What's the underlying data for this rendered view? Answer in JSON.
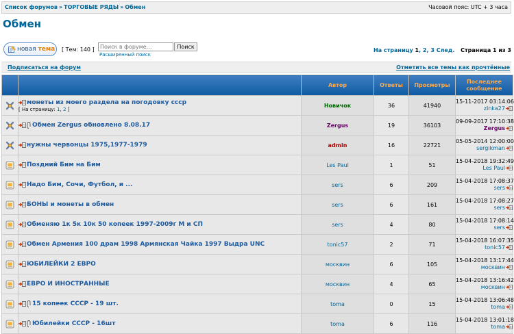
{
  "breadcrumb": {
    "items": [
      "Список форумов",
      "ТОРГОВЫЕ РЯДЫ",
      "Обмен"
    ],
    "separator": "»"
  },
  "timezone": "Часовой пояс: UTC + 3 часа",
  "forum_title": "Обмен",
  "new_topic": {
    "prefix": "новая ",
    "accent": "тема"
  },
  "topics_count": "[ Тем: 140 ]",
  "search": {
    "placeholder": "Поиск в форуме…",
    "button": "Поиск",
    "advanced": "Расширенный поиск"
  },
  "pagination": {
    "prefix": "На страницу",
    "pages": [
      "1",
      "2",
      "3"
    ],
    "current": "1",
    "next": "След.",
    "info": "Страница 1 из 3"
  },
  "actions": {
    "subscribe": "Подписаться на форум",
    "mark_read": "Отметить все темы как прочтённые"
  },
  "columns": {
    "author": "Автор",
    "replies": "Ответы",
    "views": "Просмотры",
    "last_post": "Последнее сообщение"
  },
  "colors": {
    "header_text": "#ffa94a",
    "link": "#006699",
    "topic_link": "#1d5a9e",
    "author_green": "#006600",
    "author_purple": "#660066",
    "author_red": "#aa0000"
  },
  "topics": [
    {
      "icon": "sticky-icon",
      "attachment": false,
      "title": "монеты из моего раздела на погодовку ссср",
      "pages_label": "[ На страницу:",
      "pages": [
        "1",
        "2"
      ],
      "pages_suffix": "]",
      "author": "Новичок",
      "author_color": "#006600",
      "replies": "36",
      "views": "41940",
      "last_date": "15-11-2017 03:14:06",
      "last_user": "zinka27",
      "last_user_color": "#006699"
    },
    {
      "icon": "sticky-icon",
      "attachment": true,
      "title": "Обмен Zergus обновлено 8.08.17",
      "author": "Zergus",
      "author_color": "#660066",
      "replies": "19",
      "views": "36103",
      "last_date": "09-09-2017 17:10:38",
      "last_user": "Zergus",
      "last_user_color": "#660066"
    },
    {
      "icon": "sticky-icon",
      "attachment": false,
      "title": "нужны червонцы 1975,1977-1979",
      "author": "admin",
      "author_color": "#aa0000",
      "replies": "16",
      "views": "22721",
      "last_date": "05-05-2014 12:00:00",
      "last_user": "sergikman",
      "last_user_color": "#006699"
    },
    {
      "icon": "topic-icon",
      "attachment": false,
      "title": "Поздний Бим на Бим",
      "author": "Les Paul",
      "author_color": "#006699",
      "replies": "1",
      "views": "51",
      "last_date": "15-04-2018 19:32:49",
      "last_user": "Les Paul",
      "last_user_color": "#006699"
    },
    {
      "icon": "topic-icon",
      "attachment": false,
      "title": "Надо Бим, Сочи, Футбол, и ...",
      "author": "sers",
      "author_color": "#006699",
      "replies": "6",
      "views": "209",
      "last_date": "15-04-2018 17:08:37",
      "last_user": "sers",
      "last_user_color": "#006699"
    },
    {
      "icon": "topic-icon",
      "attachment": false,
      "title": "БОНЫ и монеты в обмен",
      "author": "sers",
      "author_color": "#006699",
      "replies": "6",
      "views": "161",
      "last_date": "15-04-2018 17:08:27",
      "last_user": "sers",
      "last_user_color": "#006699"
    },
    {
      "icon": "topic-icon",
      "attachment": false,
      "title": "Обменяю 1к 5к 10к 50 копеек 1997-2009г М и СП",
      "author": "sers",
      "author_color": "#006699",
      "replies": "4",
      "views": "80",
      "last_date": "15-04-2018 17:08:14",
      "last_user": "sers",
      "last_user_color": "#006699"
    },
    {
      "icon": "topic-icon",
      "attachment": false,
      "title": "Обмен Армения 100 драм 1998 Армянская Чайка 1997 Выдра UNC",
      "author": "tonic57",
      "author_color": "#006699",
      "replies": "2",
      "views": "71",
      "last_date": "15-04-2018 16:07:35",
      "last_user": "tonic57",
      "last_user_color": "#006699"
    },
    {
      "icon": "topic-icon",
      "attachment": false,
      "title": "ЮБИЛЕЙКИ 2 ЕВРО",
      "author": "москвин",
      "author_color": "#006699",
      "replies": "6",
      "views": "105",
      "last_date": "15-04-2018 13:17:44",
      "last_user": "москвин",
      "last_user_color": "#006699"
    },
    {
      "icon": "topic-icon",
      "attachment": false,
      "title": "ЕВРО И ИНОСТРАННЫЕ",
      "author": "москвин",
      "author_color": "#006699",
      "replies": "4",
      "views": "65",
      "last_date": "15-04-2018 13:16:42",
      "last_user": "москвин",
      "last_user_color": "#006699"
    },
    {
      "icon": "topic-icon",
      "attachment": true,
      "title": "15 копеек СССР - 19 шт.",
      "author": "toma",
      "author_color": "#006699",
      "replies": "0",
      "views": "15",
      "last_date": "15-04-2018 13:06:48",
      "last_user": "toma",
      "last_user_color": "#006699"
    },
    {
      "icon": "topic-icon",
      "attachment": true,
      "title": "Юбилейки СССР - 16шт",
      "author": "toma",
      "author_color": "#006699",
      "replies": "6",
      "views": "116",
      "last_date": "15-04-2018 13:01:18",
      "last_user": "toma",
      "last_user_color": "#006699"
    }
  ]
}
